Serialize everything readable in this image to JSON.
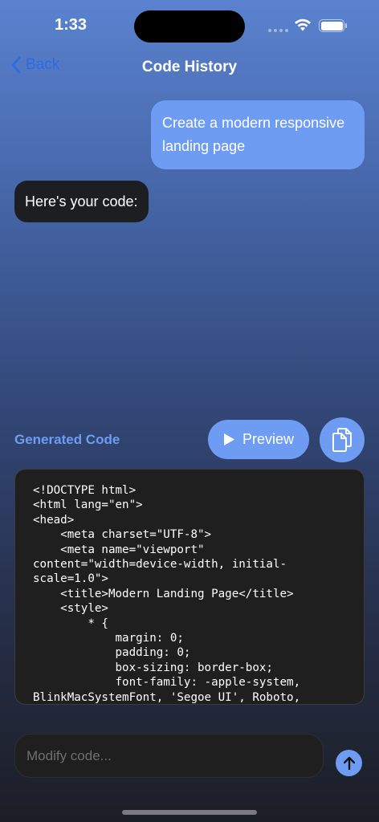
{
  "status": {
    "time": "1:33"
  },
  "nav": {
    "back_label": "Back",
    "title": "Code History"
  },
  "messages": {
    "user": "Create a modern responsive landing page",
    "assistant": "Here's your code:"
  },
  "code_panel": {
    "title": "Generated Code",
    "preview_label": "Preview",
    "code": "<!DOCTYPE html>\n<html lang=\"en\">\n<head>\n    <meta charset=\"UTF-8\">\n    <meta name=\"viewport\"\ncontent=\"width=device-width, initial-\nscale=1.0\">\n    <title>Modern Landing Page</title>\n    <style>\n        * {\n            margin: 0;\n            padding: 0;\n            box-sizing: border-box;\n            font-family: -apple-system,\nBlinkMacSystemFont, 'Segoe UI', Roboto,"
  },
  "input": {
    "placeholder": "Modify code..."
  },
  "colors": {
    "accent": "#6f9cf3",
    "back_link": "#2a6be8",
    "panel_bg": "#1f1f1f"
  },
  "icons": {
    "back": "chevron-left-icon",
    "preview": "play-icon",
    "copy": "copy-icon",
    "send": "arrow-up-icon"
  }
}
